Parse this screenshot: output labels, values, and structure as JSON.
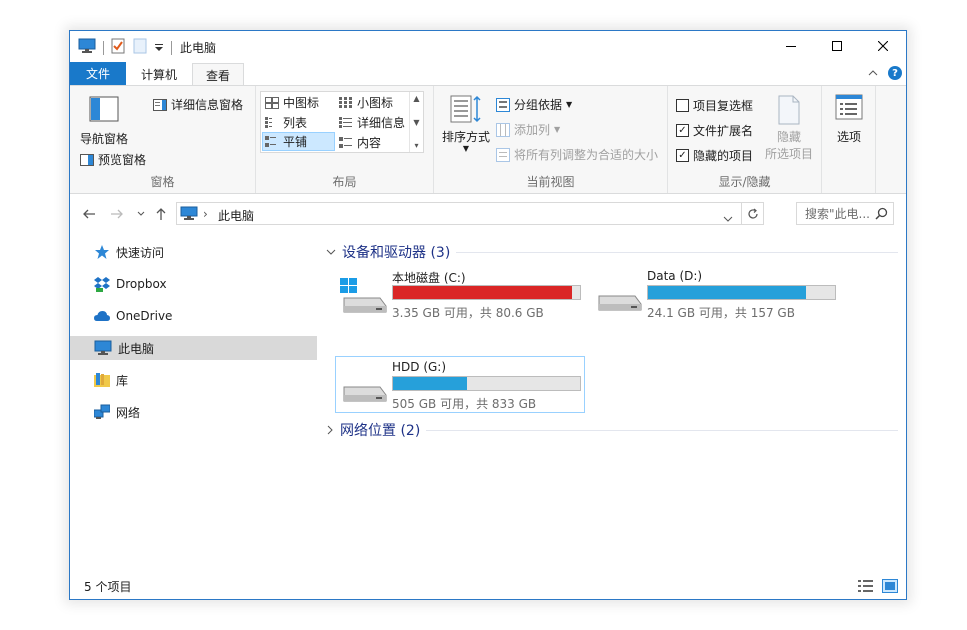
{
  "window": {
    "title": "此电脑"
  },
  "tabs": {
    "file": "文件",
    "computer": "计算机",
    "view": "查看"
  },
  "ribbon": {
    "panes": {
      "label": "窗格",
      "nav_pane": "导航窗格",
      "preview_pane": "预览窗格",
      "details_pane": "详细信息窗格"
    },
    "layout": {
      "label": "布局",
      "items": [
        "中图标",
        "小图标",
        "列表",
        "详细信息",
        "平铺",
        "内容"
      ],
      "selected": "平铺"
    },
    "current_view": {
      "label": "当前视图",
      "sort_by": "排序方式",
      "group_by": "分组依据",
      "add_columns": "添加列",
      "size_all_columns": "将所有列调整为合适的大小"
    },
    "show_hide": {
      "label": "显示/隐藏",
      "item_checkboxes": "项目复选框",
      "file_extensions": "文件扩展名",
      "hidden_items": "隐藏的项目",
      "item_checkboxes_checked": false,
      "file_extensions_checked": true,
      "hidden_items_checked": true,
      "hide_selected": "隐藏",
      "hide_selected_sub": "所选项目"
    },
    "options": {
      "label": "选项"
    }
  },
  "address": {
    "path": "此电脑",
    "search_placeholder": "搜索\"此电..."
  },
  "navpane": {
    "items": [
      {
        "label": "快速访问",
        "icon": "star-icon"
      },
      {
        "label": "Dropbox",
        "icon": "dropbox-icon"
      },
      {
        "label": "OneDrive",
        "icon": "cloud-icon"
      },
      {
        "label": "此电脑",
        "icon": "computer-icon",
        "selected": true
      },
      {
        "label": "库",
        "icon": "library-icon"
      },
      {
        "label": "网络",
        "icon": "network-icon"
      }
    ]
  },
  "content": {
    "devices_header": "设备和驱动器 (3)",
    "network_header": "网络位置 (2)",
    "drives": [
      {
        "name": "本地磁盘 (C:)",
        "info": "3.35 GB 可用，共 80.6 GB",
        "used_fraction": 0.958,
        "color": "#da2626"
      },
      {
        "name": "Data (D:)",
        "info": "24.1 GB 可用，共 157 GB",
        "used_fraction": 0.846,
        "color": "#26a0da"
      },
      {
        "name": "HDD (G:)",
        "info": "505 GB 可用，共 833 GB",
        "used_fraction": 0.394,
        "color": "#26a0da"
      }
    ]
  },
  "status": {
    "count": "5 个项目"
  },
  "colors": {
    "accent": "#1979ca",
    "selection": "#cce8ff",
    "header_text": "#1e3287"
  }
}
